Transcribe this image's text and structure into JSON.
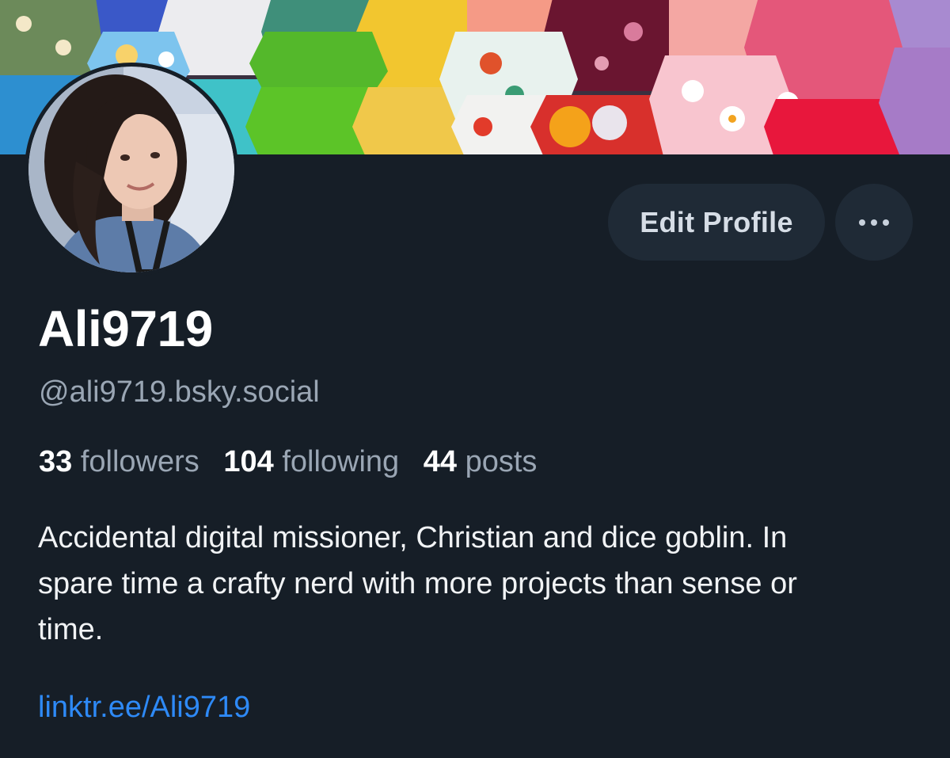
{
  "profile": {
    "display_name": "Ali9719",
    "handle": "@ali9719.bsky.social",
    "bio": "Accidental digital missioner, Christian and dice goblin. In spare time a crafty nerd with more projects than sense or time.",
    "link": "linktr.ee/Ali9719"
  },
  "stats": {
    "followers_count": "33",
    "followers_label": "followers",
    "following_count": "104",
    "following_label": "following",
    "posts_count": "44",
    "posts_label": "posts"
  },
  "actions": {
    "edit_profile_label": "Edit Profile",
    "more_icon": "ellipsis-icon"
  },
  "colors": {
    "background": "#161e27",
    "button_bg": "#1f2a36",
    "link": "#2e8af7",
    "muted_text": "#9aa6b4"
  }
}
